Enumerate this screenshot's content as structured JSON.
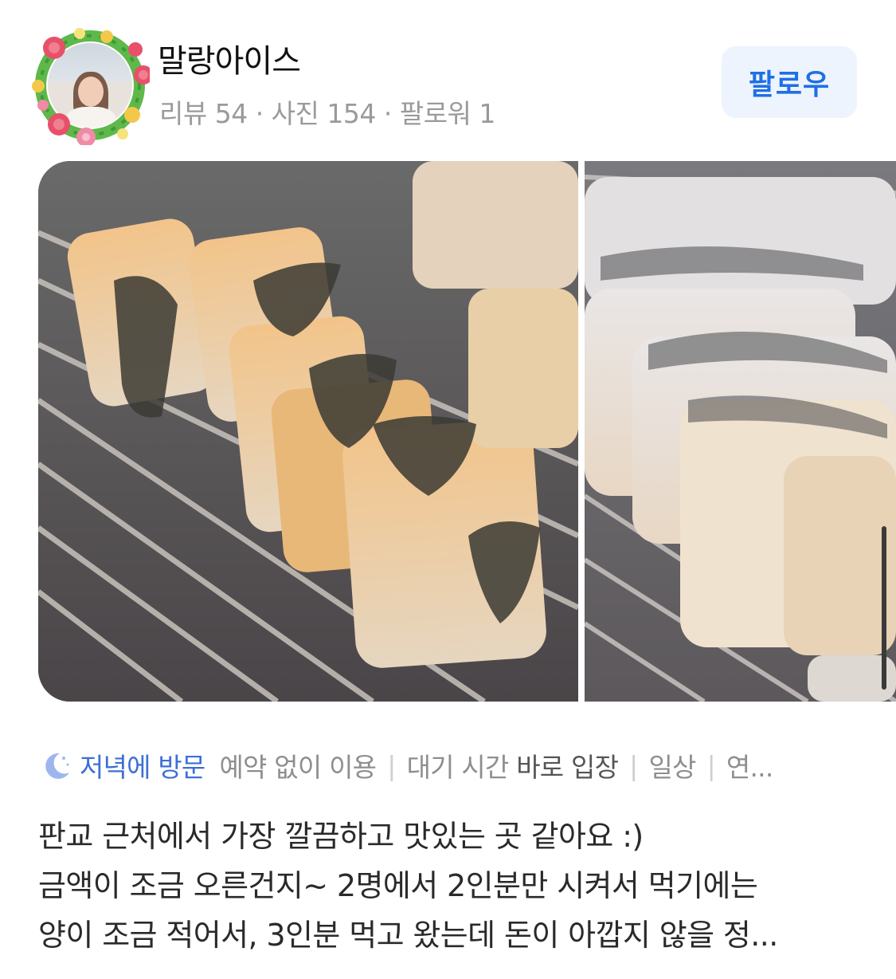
{
  "profile": {
    "username": "말랑아이스",
    "stats": "리뷰 54 · 사진 154 · 팔로워 1",
    "follow_label": "팔로우"
  },
  "photos": [
    {
      "icon": "grilled-eel-photo"
    },
    {
      "icon": "grilled-eel-photo"
    }
  ],
  "tags": {
    "visit": "저녁에 방문",
    "items": [
      {
        "plain": "예약 없이 이용",
        "bold": ""
      },
      {
        "plain": "대기 시간 ",
        "bold": "바로 입장"
      },
      {
        "plain": "일상",
        "bold": ""
      },
      {
        "plain": "연...",
        "bold": ""
      }
    ],
    "separator": "|"
  },
  "review": {
    "lines": [
      "판교 근처에서 가장 깔끔하고 맛있는 곳 같아요 :)",
      "금액이 조금 오른건지~ 2명에서 2인분만 시켜서 먹기에는",
      "양이 조금 적어서, 3인분 먹고 왔는데 돈이 아깝지 않을 정..."
    ]
  },
  "colors": {
    "accent": "#1f6fe6",
    "visit_tag": "#3d6fd6",
    "follow_bg": "#eef4fd",
    "muted_text": "#9a9a9a"
  }
}
